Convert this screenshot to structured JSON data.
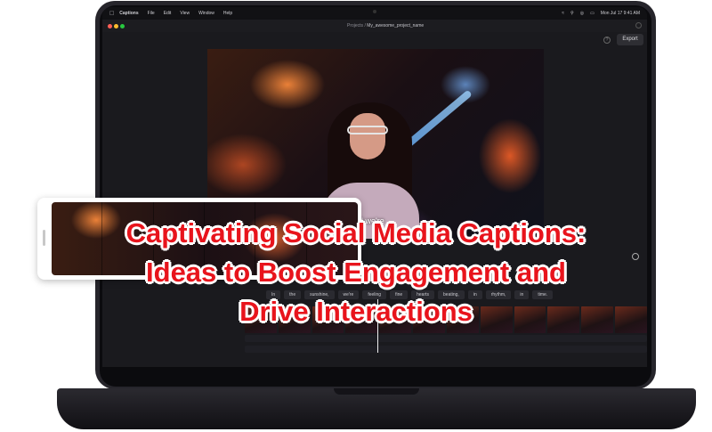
{
  "menubar": {
    "app_name": "Captions",
    "items": [
      "File",
      "Edit",
      "View",
      "Window",
      "Help"
    ],
    "datetime": "Mon Jul 17  9:41 AM"
  },
  "titlebar": {
    "breadcrumb_root": "Projects",
    "project_name": "My_awesome_project_name"
  },
  "toolbar": {
    "export_label": "Export"
  },
  "video": {
    "caption_text": "und we're"
  },
  "transcript": {
    "words": [
      "In",
      "the",
      "sunshine,",
      "we're",
      "feeling",
      "fine",
      "hearts",
      "beating,",
      "in",
      "rhythm,",
      "in",
      "time."
    ]
  },
  "headline": {
    "line1": "Captivating Social Media Captions:",
    "line2": "Ideas to Boost Engagement and",
    "line3": "Drive Interactions",
    "color": "#e8141c"
  }
}
